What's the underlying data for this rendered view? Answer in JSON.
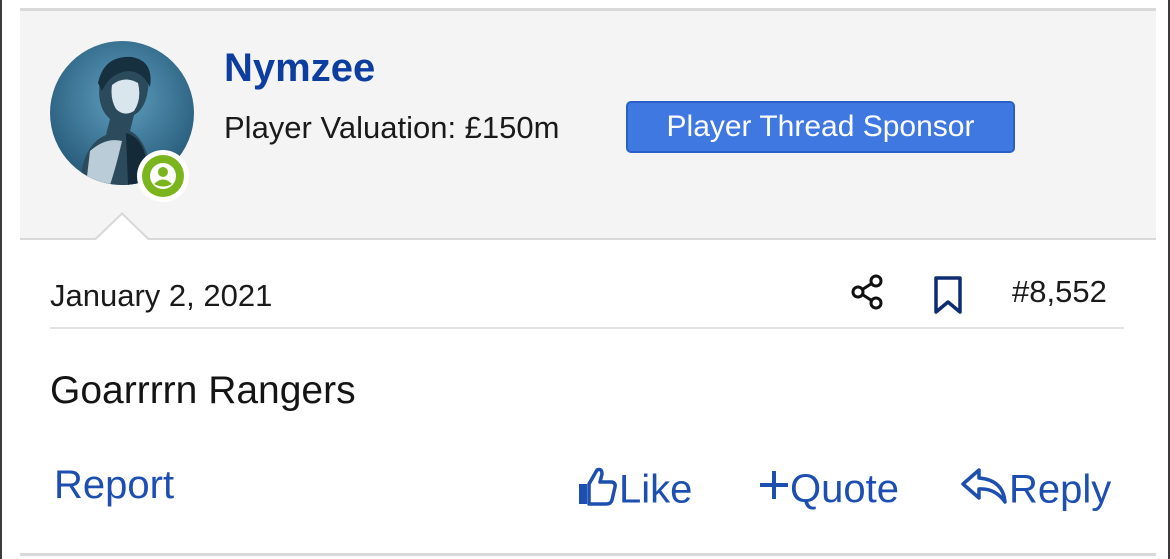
{
  "post": {
    "username": "Nymzee",
    "valuation": "Player Valuation: £150m",
    "badge": "Player Thread Sponsor",
    "date": "January 2, 2021",
    "post_number": "#8,552",
    "message": "Goarrrrn Rangers"
  },
  "actions": {
    "report": "Report",
    "like": "Like",
    "quote": "Quote",
    "reply": "Reply"
  },
  "icons": {
    "share": "share-icon",
    "bookmark": "bookmark-icon",
    "like": "thumbs-up-icon",
    "quote": "plus-icon",
    "reply": "reply-arrow-icon",
    "online": "user-online-icon"
  },
  "colors": {
    "link": "#1d4fb0",
    "username": "#0d3d9e",
    "badge_bg": "#3f78e0",
    "online": "#7ab51d",
    "header_bg": "#f4f4f4"
  }
}
